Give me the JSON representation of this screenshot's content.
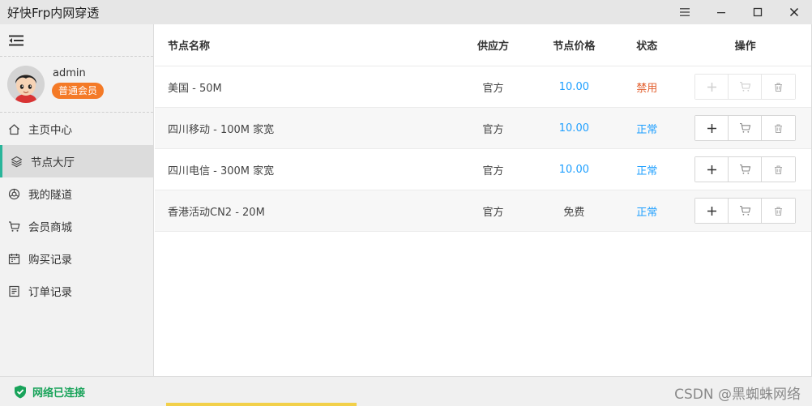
{
  "window": {
    "title": "好快Frp内网穿透"
  },
  "sidebar": {
    "username": "admin",
    "membership": "普通会员",
    "items": [
      {
        "label": "主页中心",
        "icon": "home-icon"
      },
      {
        "label": "节点大厅",
        "icon": "layers-icon",
        "active": true
      },
      {
        "label": "我的隧道",
        "icon": "tunnel-icon"
      },
      {
        "label": "会员商城",
        "icon": "cart-icon"
      },
      {
        "label": "购买记录",
        "icon": "calendar-icon"
      },
      {
        "label": "订单记录",
        "icon": "document-icon"
      }
    ]
  },
  "table": {
    "headers": {
      "name": "节点名称",
      "provider": "供应方",
      "price": "节点价格",
      "status": "状态",
      "actions": "操作"
    },
    "rows": [
      {
        "name": "美国 - 50M",
        "provider": "官方",
        "price": "10.00",
        "status": "禁用",
        "enabled": false
      },
      {
        "name": "四川移动 - 100M 家宽",
        "provider": "官方",
        "price": "10.00",
        "status": "正常",
        "enabled": true
      },
      {
        "name": "四川电信 - 300M 家宽",
        "provider": "官方",
        "price": "10.00",
        "status": "正常",
        "enabled": true
      },
      {
        "name": "香港活动CN2 - 20M",
        "provider": "官方",
        "price": "免费",
        "status": "正常",
        "enabled": true
      }
    ]
  },
  "statusbar": {
    "connection": "网络已连接",
    "watermark": "CSDN @黑蜘蛛网络"
  },
  "colors": {
    "accent": "#29b59a",
    "link": "#1e9fff",
    "disabled": "#e25c2a",
    "badge": "#f47a27",
    "connected": "#19a35a"
  }
}
